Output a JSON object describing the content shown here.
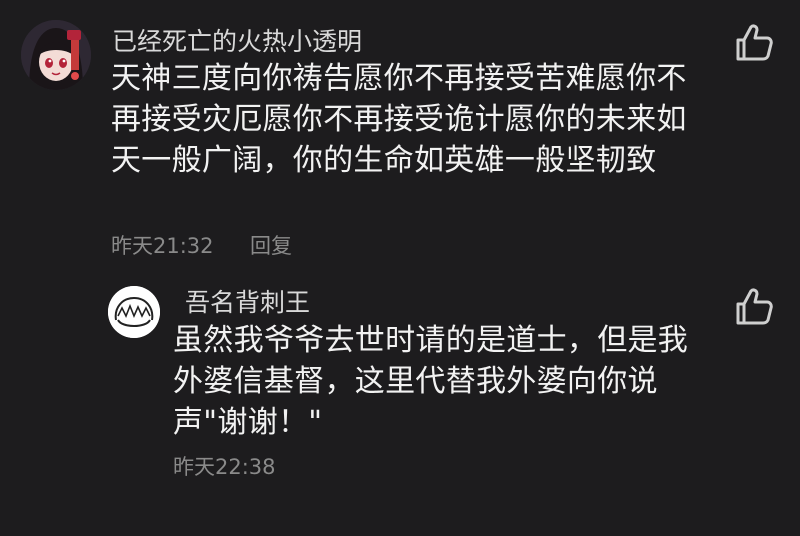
{
  "comments": [
    {
      "username": "已经死亡的火热小透明",
      "text": "天神三度向你祷告愿你不再接受苦难愿你不再接受灾厄愿你不再接受诡计愿你的未来如天一般广阔，你的生命如英雄一般坚韧致",
      "time": "昨天21:32",
      "reply_label": "回复",
      "like_icon": "thumbs-up-icon"
    }
  ],
  "replies": [
    {
      "username": "吾名背刺王",
      "text": "虽然我爷爷去世时请的是道士，但是我外婆信基督，这里代替我外婆向你说声\"谢谢！\"",
      "time": "昨天22:38",
      "like_icon": "thumbs-up-icon"
    }
  ],
  "colors": {
    "background": "#1d1c1e",
    "primary_text": "#f2f2f2",
    "username_text": "#d9d9d9",
    "meta_text": "#8a8a8a",
    "icon": "#cfcfcf"
  }
}
